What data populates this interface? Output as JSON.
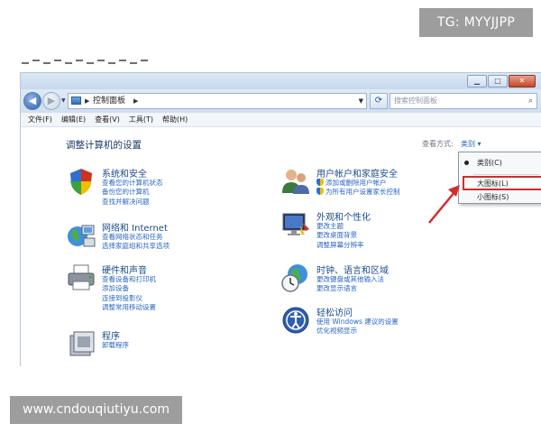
{
  "watermarks": {
    "top": "TG: MYYJJPP",
    "bottom": "www.cndouqiutiyu.com"
  },
  "window": {
    "controls": {
      "minimize": "▁",
      "maximize": "□",
      "close": "✕"
    },
    "nav": {
      "back_glyph": "◀",
      "forward_glyph": "▶",
      "breadcrumb": "控制面板",
      "search_placeholder": "搜索控制面板"
    },
    "menu": [
      "文件(F)",
      "编辑(E)",
      "查看(V)",
      "工具(T)",
      "帮助(H)"
    ],
    "content": {
      "heading": "调整计算机的设置",
      "view_by_label": "查看方式:",
      "view_by_value": "类别 ▾"
    },
    "categories": [
      {
        "name": "system-security",
        "icon": "shield-icon",
        "title": "系统和安全",
        "links": [
          "查看您的计算机状态",
          "备份您的计算机",
          "查找并解决问题"
        ]
      },
      {
        "name": "network-internet",
        "icon": "globe-network-icon",
        "title": "网络和 Internet",
        "links": [
          "查看网络状态和任务",
          "选择家庭组和共享选项"
        ]
      },
      {
        "name": "hardware-sound",
        "icon": "printer-icon",
        "title": "硬件和声音",
        "links": [
          "查看设备和打印机",
          "添加设备",
          "连接到投影仪",
          "调整常用移动设置"
        ]
      },
      {
        "name": "programs",
        "icon": "programs-icon",
        "title": "程序",
        "links": [
          "卸载程序"
        ]
      },
      {
        "name": "user-accounts",
        "icon": "users-icon",
        "title": "用户帐户和家庭安全",
        "links": [
          "添加或删除用户帐户",
          "为所有用户设置家长控制"
        ]
      },
      {
        "name": "appearance",
        "icon": "display-icon",
        "title": "外观和个性化",
        "links": [
          "更改主题",
          "更改桌面背景",
          "调整屏幕分辨率"
        ]
      },
      {
        "name": "clock-region",
        "icon": "clock-globe-icon",
        "title": "时钟、语言和区域",
        "links": [
          "更改键盘或其他输入法",
          "更改显示语言"
        ]
      },
      {
        "name": "ease-of-access",
        "icon": "accessibility-icon",
        "title": "轻松访问",
        "links": [
          "使用 Windows 建议的设置",
          "优化视频显示"
        ]
      }
    ],
    "view_menu": {
      "options": [
        "类别(C)",
        "大图标(L)",
        "小图标(S)"
      ],
      "selected": "类别(C)",
      "highlighted": "大图标(L)",
      "highlight_color": "#d42b2b"
    }
  }
}
